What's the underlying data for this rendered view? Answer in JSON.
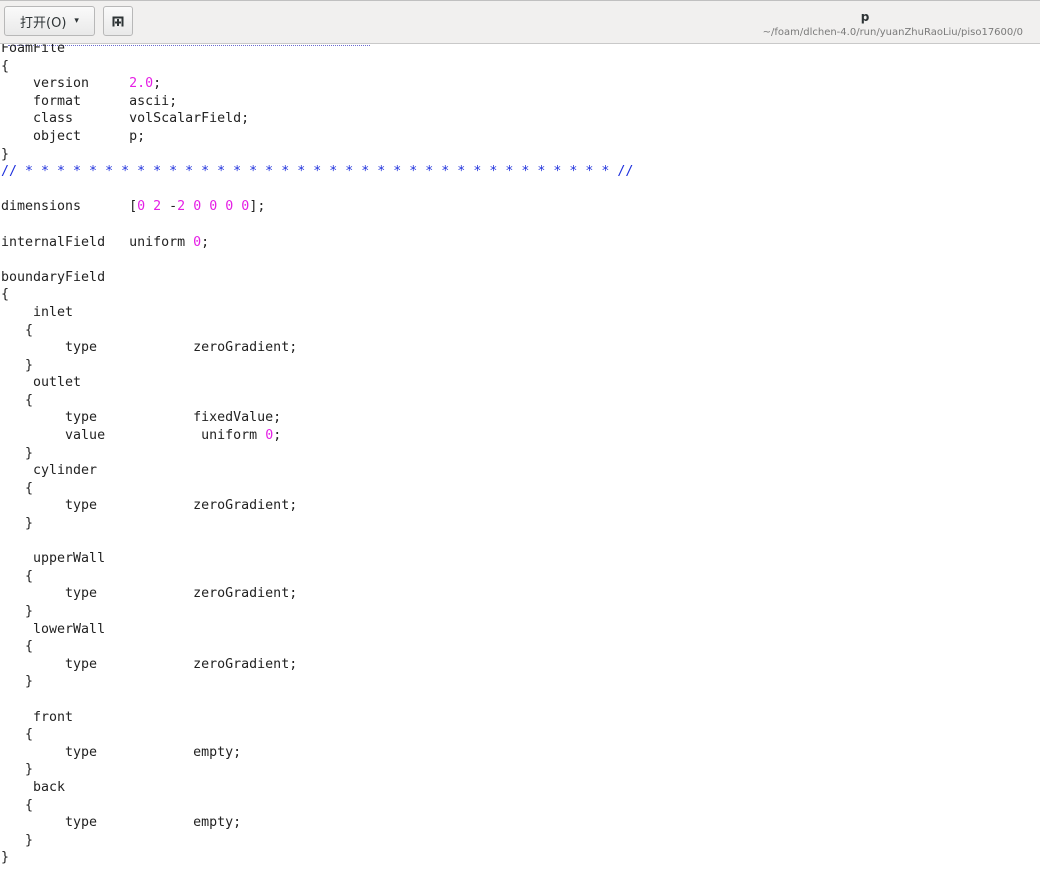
{
  "toolbar": {
    "open_label": "打开(O)",
    "open_caret": "▾",
    "pin_icon": "pin-icon"
  },
  "title": {
    "name": "p",
    "path": "~/foam/dlchen-4.0/run/yuanZhuRaoLiu/piso17600/0"
  },
  "colors": {
    "number": "#e51fe5",
    "comment": "#1d2fdc",
    "text": "#222222"
  },
  "code": {
    "lines": [
      {
        "t": "FoamFile"
      },
      {
        "t": "{"
      },
      {
        "t": "    version     ",
        "n": "2.0",
        ";": ";"
      },
      {
        "t": "    format      ascii;"
      },
      {
        "t": "    class       volScalarField;"
      },
      {
        "t": "    object      p;"
      },
      {
        "t": "}"
      },
      {
        "c": "// * * * * * * * * * * * * * * * * * * * * * * * * * * * * * * * * * * * * * //"
      },
      {
        "t": ""
      },
      {
        "dims": true
      },
      {
        "t": ""
      },
      {
        "t": "internalField   uniform ",
        "n": "0",
        ";": ";"
      },
      {
        "t": ""
      },
      {
        "t": "boundaryField"
      },
      {
        "t": "{"
      },
      {
        "t": "    inlet"
      },
      {
        "t": "   {"
      },
      {
        "t": "        type            zeroGradient;"
      },
      {
        "t": "   }"
      },
      {
        "t": "    outlet"
      },
      {
        "t": "   {"
      },
      {
        "t": "        type            fixedValue;"
      },
      {
        "t": "        value            uniform ",
        "n": "0",
        ";": ";"
      },
      {
        "t": "   }"
      },
      {
        "t": "    cylinder"
      },
      {
        "t": "   {"
      },
      {
        "t": "        type            zeroGradient;"
      },
      {
        "t": "   }"
      },
      {
        "t": ""
      },
      {
        "t": "    upperWall"
      },
      {
        "t": "   {"
      },
      {
        "t": "        type            zeroGradient;"
      },
      {
        "t": "   }"
      },
      {
        "t": "    lowerWall"
      },
      {
        "t": "   {"
      },
      {
        "t": "        type            zeroGradient;"
      },
      {
        "t": "   }"
      },
      {
        "t": ""
      },
      {
        "t": "    front"
      },
      {
        "t": "   {"
      },
      {
        "t": "        type            empty;"
      },
      {
        "t": "   }"
      },
      {
        "t": "    back"
      },
      {
        "t": "   {"
      },
      {
        "t": "        type            empty;"
      },
      {
        "t": "   }"
      },
      {
        "t": "}"
      }
    ],
    "dimensions": {
      "label": "dimensions      ",
      "open": "[",
      "values": [
        "0",
        "2",
        "-2",
        "0",
        "0",
        "0",
        "0"
      ],
      "close": "];"
    }
  }
}
